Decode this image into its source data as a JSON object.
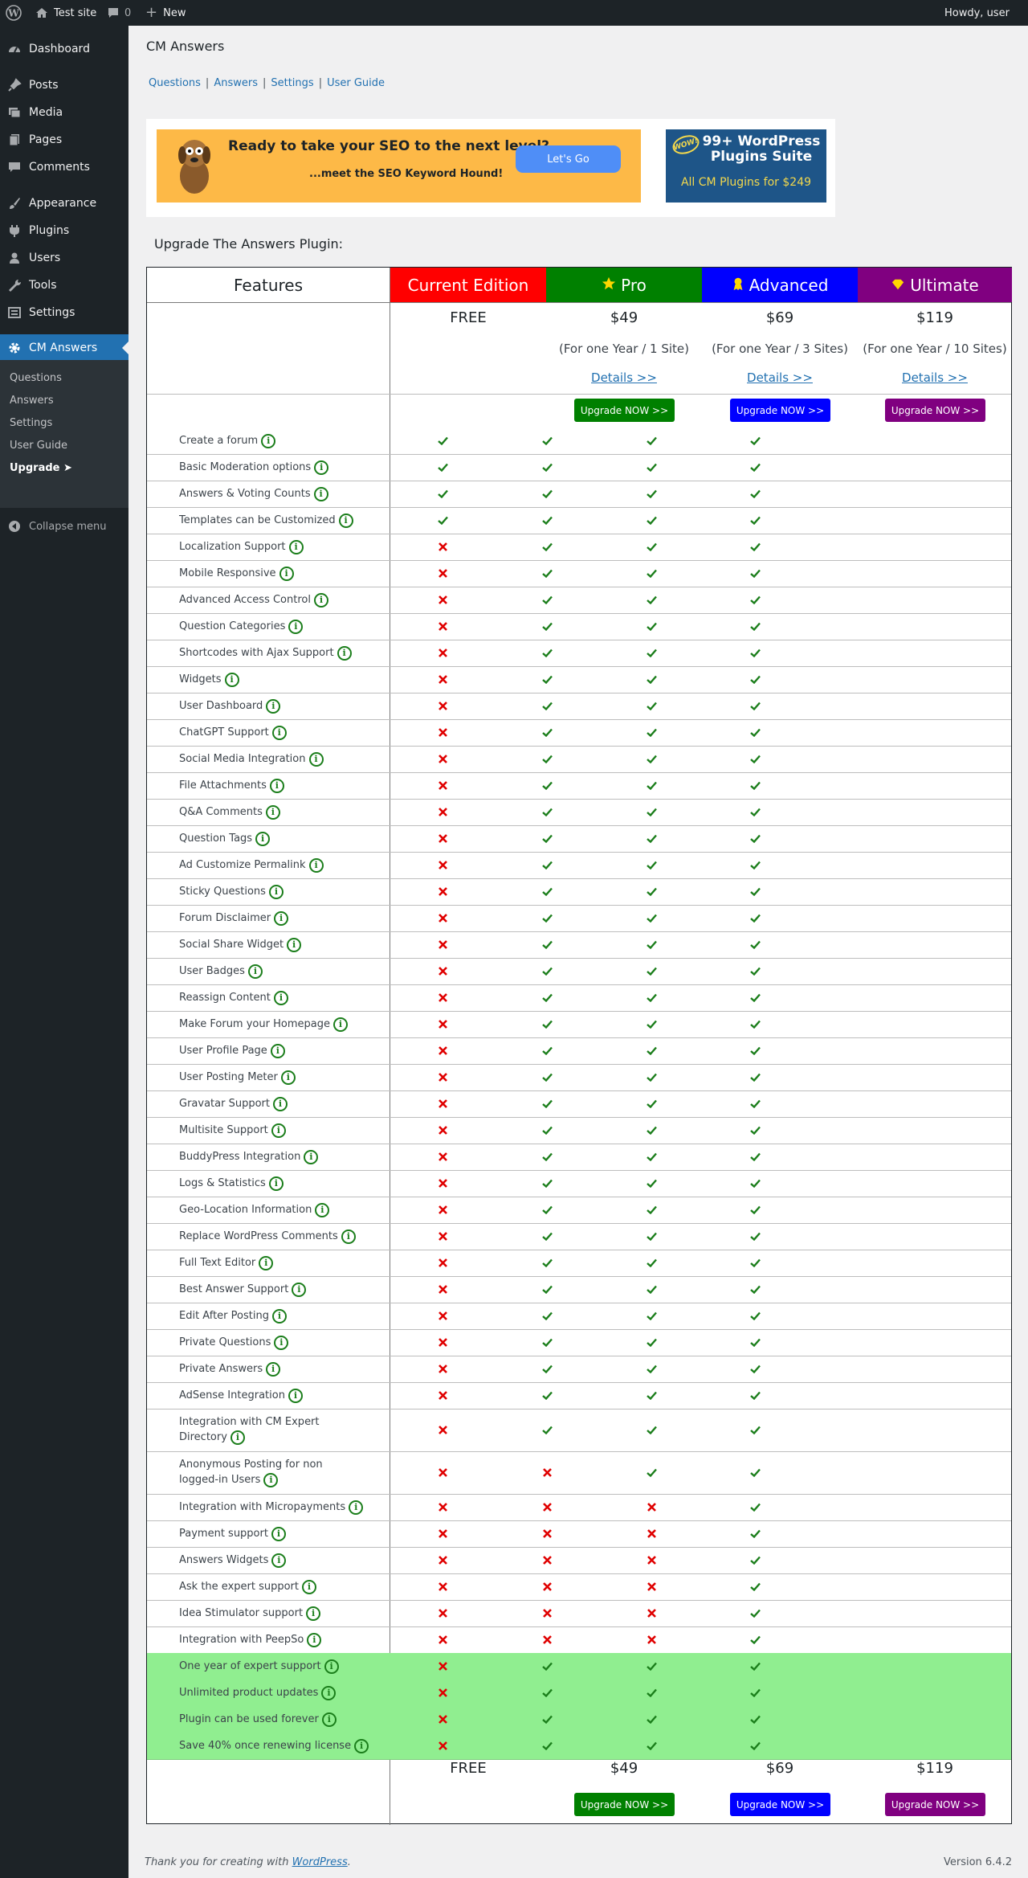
{
  "admin_bar": {
    "site_name": "Test site",
    "comments_count": "0",
    "new_label": "New",
    "greeting": "Howdy, user"
  },
  "sidebar": {
    "items": [
      {
        "label": "Dashboard",
        "icon": "dashboard-icon"
      },
      {
        "label": "Posts",
        "icon": "pin-icon"
      },
      {
        "label": "Media",
        "icon": "media-icon"
      },
      {
        "label": "Pages",
        "icon": "pages-icon"
      },
      {
        "label": "Comments",
        "icon": "comment-icon"
      },
      {
        "label": "Appearance",
        "icon": "brush-icon"
      },
      {
        "label": "Plugins",
        "icon": "plugin-icon"
      },
      {
        "label": "Users",
        "icon": "users-icon"
      },
      {
        "label": "Tools",
        "icon": "wrench-icon"
      },
      {
        "label": "Settings",
        "icon": "settings-icon"
      },
      {
        "label": "CM Answers",
        "icon": "gear-icon"
      }
    ],
    "submenu": [
      "Questions",
      "Answers",
      "Settings",
      "User Guide",
      "Upgrade ➤"
    ],
    "collapse_label": "Collapse menu"
  },
  "page": {
    "title": "CM Answers",
    "tabs": [
      "Questions",
      "Answers",
      "Settings",
      "User Guide"
    ],
    "banner": {
      "headline": "Ready to take your SEO to the next level?",
      "subline": "...meet the SEO Keyword Hound!",
      "button": "Let's Go",
      "wow": "WOW!",
      "plugins_title": "99+ WordPress Plugins Suite",
      "plugins_offer": "All CM Plugins for $249"
    },
    "upgrade_heading": "Upgrade The Answers Plugin:"
  },
  "table": {
    "features_label": "Features",
    "plans": [
      {
        "name": "Current Edition",
        "price": "FREE",
        "period": "",
        "details": "",
        "button": "",
        "color": "#ff0000",
        "icon": ""
      },
      {
        "name": "Pro",
        "price": "$49",
        "period": "(For one Year / 1 Site)",
        "details": "Details >>",
        "button": "Upgrade NOW >>",
        "color": "#008000",
        "icon": "star-icon"
      },
      {
        "name": "Advanced",
        "price": "$69",
        "period": "(For one Year / 3 Sites)",
        "details": "Details >>",
        "button": "Upgrade NOW >>",
        "color": "#0000ff",
        "icon": "ribbon-icon"
      },
      {
        "name": "Ultimate",
        "price": "$119",
        "period": "(For one Year / 10 Sites)",
        "details": "Details >>",
        "button": "Upgrade NOW >>",
        "color": "#800080",
        "icon": "diamond-icon"
      }
    ],
    "info_glyph": "i",
    "rows": [
      {
        "f": "Create a forum",
        "v": "YYYY"
      },
      {
        "f": "Basic Moderation options",
        "v": "YYYY"
      },
      {
        "f": "Answers & Voting Counts",
        "v": "YYYY"
      },
      {
        "f": "Templates can be Customized",
        "v": "YYYY"
      },
      {
        "f": "Localization Support",
        "v": "NYYY"
      },
      {
        "f": "Mobile Responsive",
        "v": "NYYY"
      },
      {
        "f": "Advanced Access Control",
        "v": "NYYY"
      },
      {
        "f": "Question Categories",
        "v": "NYYY"
      },
      {
        "f": "Shortcodes with Ajax Support",
        "v": "NYYY"
      },
      {
        "f": "Widgets",
        "v": "NYYY"
      },
      {
        "f": "User Dashboard",
        "v": "NYYY"
      },
      {
        "f": "ChatGPT Support",
        "v": "NYYY"
      },
      {
        "f": "Social Media Integration",
        "v": "NYYY"
      },
      {
        "f": "File Attachments",
        "v": "NYYY"
      },
      {
        "f": "Q&A Comments",
        "v": "NYYY"
      },
      {
        "f": "Question Tags",
        "v": "NYYY"
      },
      {
        "f": "Ad Customize Permalink",
        "v": "NYYY"
      },
      {
        "f": "Sticky Questions",
        "v": "NYYY"
      },
      {
        "f": "Forum Disclaimer",
        "v": "NYYY"
      },
      {
        "f": "Social Share Widget",
        "v": "NYYY"
      },
      {
        "f": "User Badges",
        "v": "NYYY"
      },
      {
        "f": "Reassign Content",
        "v": "NYYY"
      },
      {
        "f": "Make Forum your Homepage",
        "v": "NYYY"
      },
      {
        "f": "User Profile Page",
        "v": "NYYY"
      },
      {
        "f": "User Posting Meter",
        "v": "NYYY"
      },
      {
        "f": "Gravatar Support",
        "v": "NYYY"
      },
      {
        "f": "Multisite Support",
        "v": "NYYY"
      },
      {
        "f": "BuddyPress Integration",
        "v": "NYYY"
      },
      {
        "f": "Logs & Statistics",
        "v": "NYYY"
      },
      {
        "f": "Geo-Location Information",
        "v": "NYYY"
      },
      {
        "f": "Replace WordPress Comments",
        "v": "NYYY"
      },
      {
        "f": "Full Text Editor",
        "v": "NYYY"
      },
      {
        "f": "Best Answer Support",
        "v": "NYYY"
      },
      {
        "f": "Edit After Posting",
        "v": "NYYY"
      },
      {
        "f": "Private Questions",
        "v": "NYYY"
      },
      {
        "f": "Private Answers",
        "v": "NYYY"
      },
      {
        "f": "AdSense Integration",
        "v": "NYYY"
      },
      {
        "f": "Integration with CM Expert Directory",
        "v": "NYYY",
        "tall": true
      },
      {
        "f": "Anonymous Posting for non logged-in Users",
        "v": "NNYY",
        "tall": true
      },
      {
        "f": "Integration with Micropayments",
        "v": "NNNY"
      },
      {
        "f": "Payment support",
        "v": "NNNY"
      },
      {
        "f": "Answers Widgets",
        "v": "NNNY"
      },
      {
        "f": "Ask the expert support",
        "v": "NNNY"
      },
      {
        "f": "Idea Stimulator support",
        "v": "NNNY"
      },
      {
        "f": "Integration with PeepSo",
        "v": "NNNY"
      },
      {
        "f": "One year of expert support",
        "v": "NYYY",
        "green": true
      },
      {
        "f": "Unlimited product updates",
        "v": "NYYY",
        "green": true
      },
      {
        "f": "Plugin can be used forever",
        "v": "NYYY",
        "green": true
      },
      {
        "f": "Save 40% once renewing license",
        "v": "NYYY",
        "green": true
      }
    ]
  },
  "footer": {
    "prefix": "Thank you for creating with ",
    "link": "WordPress",
    "suffix": ".",
    "version": "Version 6.4.2"
  }
}
